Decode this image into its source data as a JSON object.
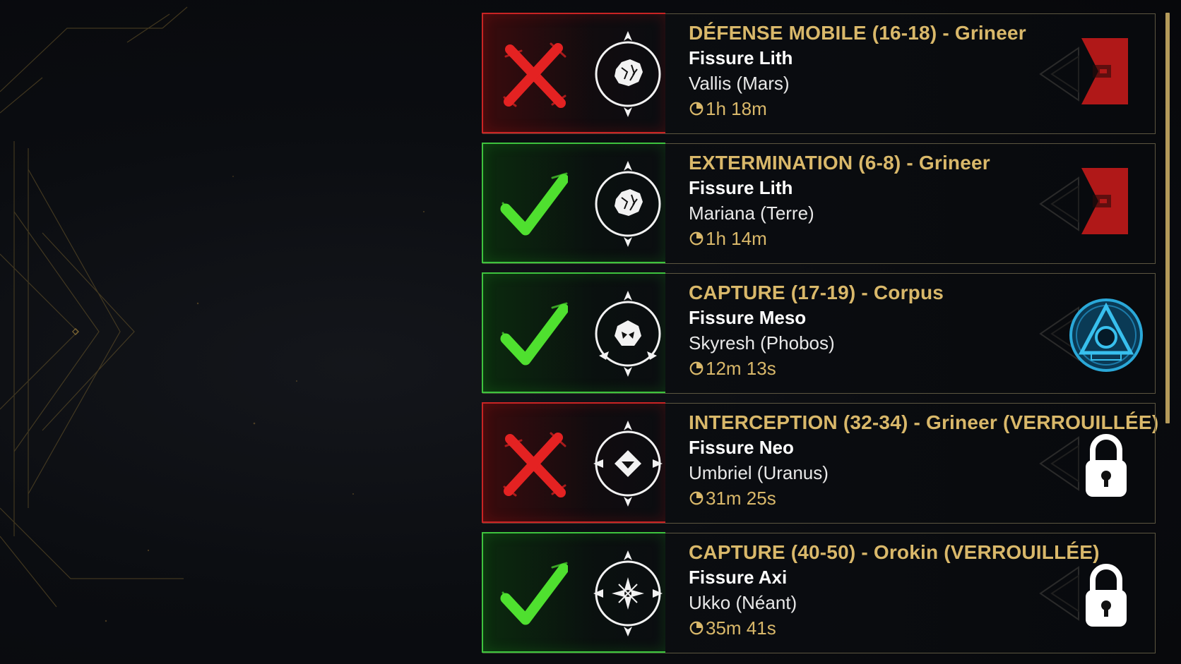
{
  "missions": [
    {
      "status": "fail",
      "status_icon": "cross-icon",
      "mission_icon": "lith-relic-icon",
      "title": "DÉFENSE MOBILE (16-18) - Grineer",
      "fissure": "Fissure Lith",
      "node": "Vallis (Mars)",
      "time": "1h 18m",
      "faction_icon": "grineer-emblem-icon",
      "locked": false
    },
    {
      "status": "ok",
      "status_icon": "check-icon",
      "mission_icon": "lith-relic-icon",
      "title": "EXTERMINATION (6-8) - Grineer",
      "fissure": "Fissure Lith",
      "node": "Mariana (Terre)",
      "time": "1h 14m",
      "faction_icon": "grineer-emblem-icon",
      "locked": false
    },
    {
      "status": "ok",
      "status_icon": "check-icon",
      "mission_icon": "meso-relic-icon",
      "title": "CAPTURE (17-19) - Corpus",
      "fissure": "Fissure Meso",
      "node": "Skyresh (Phobos)",
      "time": "12m 13s",
      "faction_icon": "corpus-emblem-icon",
      "locked": false
    },
    {
      "status": "fail",
      "status_icon": "cross-icon",
      "mission_icon": "neo-relic-icon",
      "title": "INTERCEPTION (32-34) - Grineer (VERROUILLÉE)",
      "fissure": "Fissure Neo",
      "node": "Umbriel (Uranus)",
      "time": "31m 25s",
      "faction_icon": "padlock-icon",
      "locked": true
    },
    {
      "status": "ok",
      "status_icon": "check-icon",
      "mission_icon": "axi-relic-icon",
      "title": "CAPTURE (40-50) - Orokin (VERROUILLÉE)",
      "fissure": "Fissure Axi",
      "node": "Ukko (Néant)",
      "time": "35m 41s",
      "faction_icon": "padlock-icon",
      "locked": true
    }
  ],
  "colors": {
    "title_gold": "#d9b86a",
    "fail_red": "#c92424",
    "ok_green": "#3ec23e",
    "scroll_gold": "#b49a5a"
  }
}
